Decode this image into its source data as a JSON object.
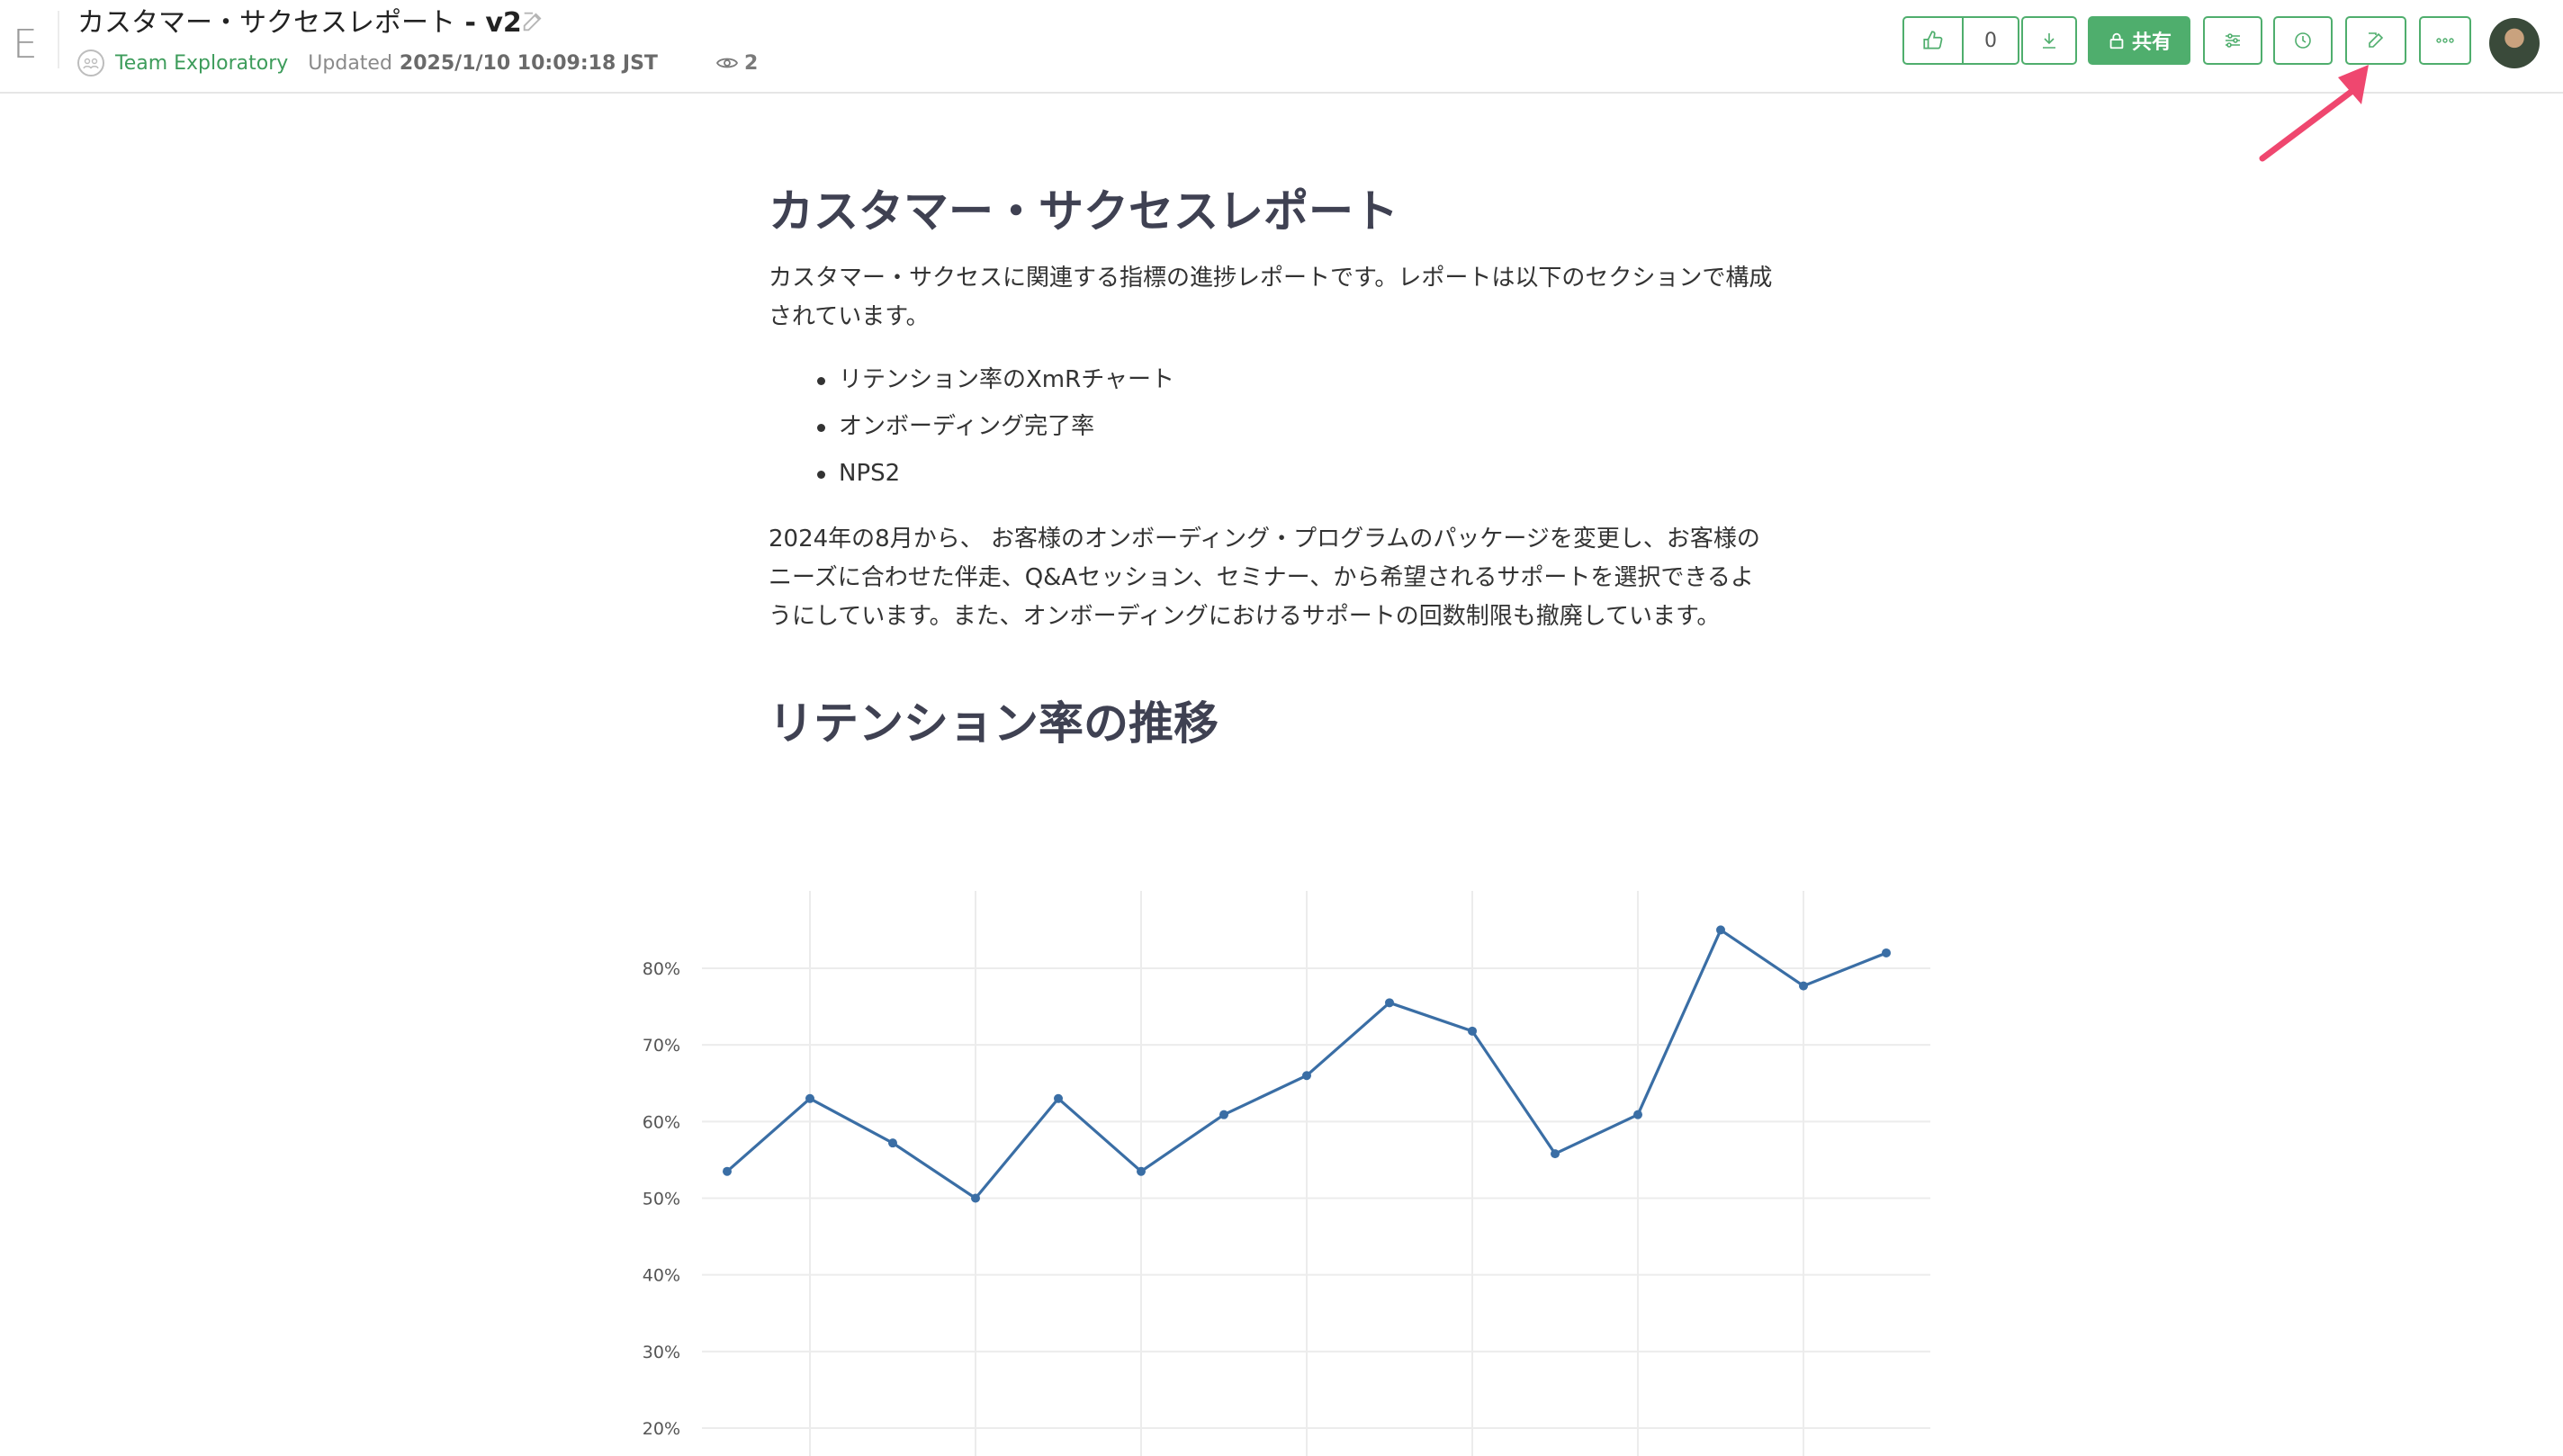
{
  "app": {
    "brand_letter": "E"
  },
  "doc": {
    "title": "カスタマー・サクセスレポート",
    "version": " - v2"
  },
  "meta": {
    "team": "Team Exploratory",
    "updated_label": "Updated",
    "updated_value": "2025/1/10 10:09:18 JST",
    "views": "2"
  },
  "toolbar": {
    "like_count": "0",
    "share_label": "共有"
  },
  "content": {
    "h1": "カスタマー・サクセスレポート",
    "intro": "カスタマー・サクセスに関連する指標の進捗レポートです。レポートは以下のセクションで構成されています。",
    "bullets": [
      "リテンション率のXmRチャート",
      "オンボーディング完了率",
      "NPS2"
    ],
    "para2": "2024年の8月から、 お客様のオンボーディング・プログラムのパッケージを変更し、お客様のニーズに合わせた伴走、Q&Aセッション、セミナー、から希望されるサポートを選択できるようにしています。また、オンボーディングにおけるサポートの回数制限も撤廃しています。",
    "h2": "リテンション率の推移"
  },
  "colors": {
    "accent_green": "#4fae6d",
    "line": "#3a6ea5",
    "heading": "#3f4152",
    "arrow": "#ef476f"
  },
  "chart_data": {
    "type": "line",
    "title": "",
    "xlabel": "",
    "ylabel": "",
    "ylim": [
      20,
      85
    ],
    "yticks": [
      20,
      30,
      40,
      50,
      60,
      70,
      80
    ],
    "ytick_labels": [
      "20%",
      "30%",
      "40%",
      "50%",
      "60%",
      "70%",
      "80%"
    ],
    "grid": true,
    "series": [
      {
        "values": [
          53.5,
          63.0,
          57.2,
          50.0,
          63.0,
          53.5,
          60.9,
          66.0,
          75.5,
          71.8,
          55.8,
          60.9,
          85.0,
          77.7,
          82.0
        ]
      }
    ]
  }
}
